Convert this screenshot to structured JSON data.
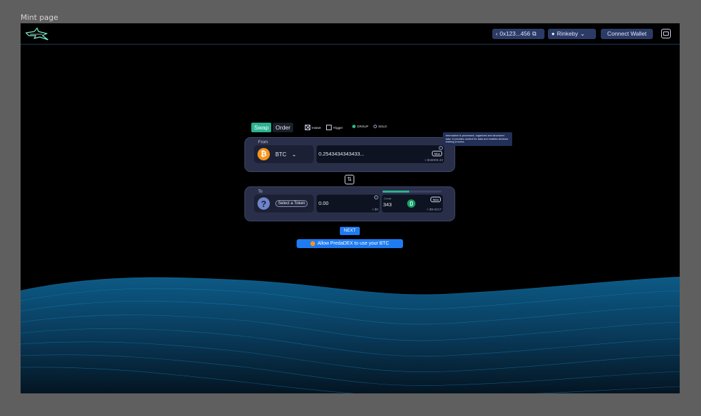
{
  "frame": {
    "label": "Mint page"
  },
  "header": {
    "address": "0x123...456",
    "network": "Rinkeby",
    "connect_wallet": "Connect Wallet"
  },
  "swap": {
    "tabs": [
      {
        "label": "Swap",
        "active": true
      },
      {
        "label": "Order",
        "active": false
      }
    ],
    "options": {
      "instant": "Instant",
      "instant_checked": true,
      "trigger": "Trigger",
      "trigger_checked": false,
      "group": "GROUP",
      "group_selected": true,
      "solo": "SOLO",
      "solo_selected": false
    },
    "tooltip": "Information is processed, organized and structured data. It provides context for data and enables decision making process.",
    "from": {
      "label": "From",
      "token": "BTC",
      "amount": "0.2543434343433...",
      "usd": "≈ $16000.43",
      "max": "Max"
    },
    "to": {
      "label": "To",
      "token_placeholder": "Select a Token",
      "amount": "0.00",
      "usd": "≈ $0",
      "gas": {
        "label": "Crude",
        "value": "343",
        "usd": "≈ $9.6217",
        "max": "Max",
        "level": 0.45
      }
    },
    "next": "NEXT",
    "allow": "Allow PredaDEX to use your BTC"
  },
  "colors": {
    "accent": "#2bb391",
    "primary_button": "#1f7bf1",
    "card": "#2a2f49",
    "btc": "#f7931a"
  }
}
